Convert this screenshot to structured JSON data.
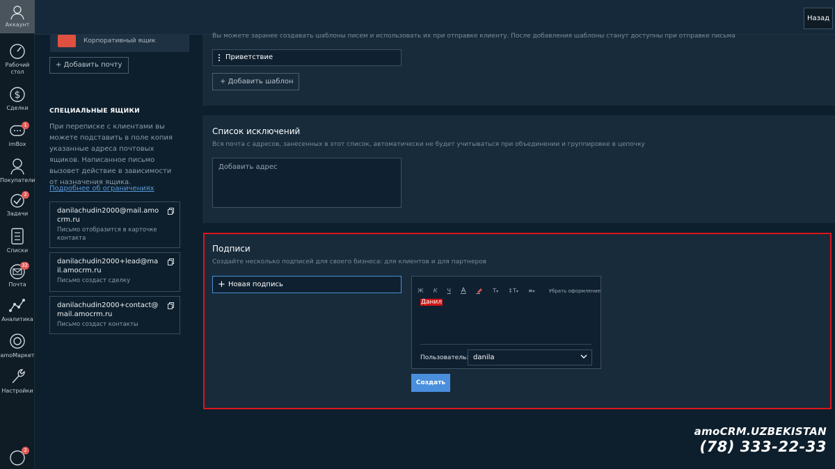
{
  "nav": {
    "account": "Аккаунт",
    "items": [
      {
        "label": "Рабочий стол",
        "icon": "dashboard-icon"
      },
      {
        "label": "Сделки",
        "icon": "dollar-icon"
      },
      {
        "label": "imBox",
        "icon": "chat-icon",
        "badge": "1"
      },
      {
        "label": "Покупатели",
        "icon": "customers-icon"
      },
      {
        "label": "Задачи",
        "icon": "tasks-icon",
        "badge": "2"
      },
      {
        "label": "Списки",
        "icon": "lists-icon"
      },
      {
        "label": "Почта",
        "icon": "mail-icon",
        "badge": "32"
      },
      {
        "label": "Аналитика",
        "icon": "analytics-icon"
      },
      {
        "label": "amoМаркет",
        "icon": "market-icon"
      },
      {
        "label": "Настройки",
        "icon": "settings-icon"
      }
    ],
    "bottom_badge": "2"
  },
  "topbar": {
    "back_label": "Назад"
  },
  "left": {
    "mail_type": "Корпоративный ящик",
    "add_mail_label": "Добавить почту",
    "special_title": "СПЕЦИАЛЬНЫЕ ЯЩИКИ",
    "special_text": "При переписке с клиентами вы можете подставить в поле копия указанные адреса почтовых ящиков. Написанное письмо вызовет действие в зависимости от назначения ящика.",
    "special_link": "Подробнее об ограничениях",
    "addresses": [
      {
        "address": "danilachudin2000@mail.amocrm.ru",
        "note": "Письмо отобразится в карточке контакта"
      },
      {
        "address": "danilachudin2000+lead@mail.amocrm.ru",
        "note": "Письмо создаст сделку"
      },
      {
        "address": "danilachudin2000+contact@mail.amocrm.ru",
        "note": "Письмо создаст контакты"
      }
    ]
  },
  "templates": {
    "description": "Вы можете заранее создавать шаблоны писем и использовать их при отправке клиенту. После добавления шаблоны станут доступны при отправке письма",
    "item": "Приветствие",
    "add_label": "Добавить шаблон"
  },
  "exclusions": {
    "title": "Список исключений",
    "description": "Вся почта с адресов, занесенных в этот список, автоматически не будет учитываться при объединении и группировке в цепочку",
    "placeholder": "Добавить адрес"
  },
  "signatures": {
    "title": "Подписи",
    "description": "Создайте несколько подписей для своего бизнеса: для клиентов и для партнеров",
    "new_label": "Новая подпись",
    "toolbar": {
      "bold": "Ж",
      "italic": "К",
      "underline": "Ч",
      "font_size": "T",
      "line_height": "↕T",
      "clear_format": "Убрать оформление"
    },
    "text": "Данил",
    "user_label": "Пользователь:",
    "user_value": "danila",
    "create_label": "Создать"
  },
  "brand": {
    "name": "amoCRM.UZBEKISTAN",
    "phone": "(78) 333-22-33"
  }
}
